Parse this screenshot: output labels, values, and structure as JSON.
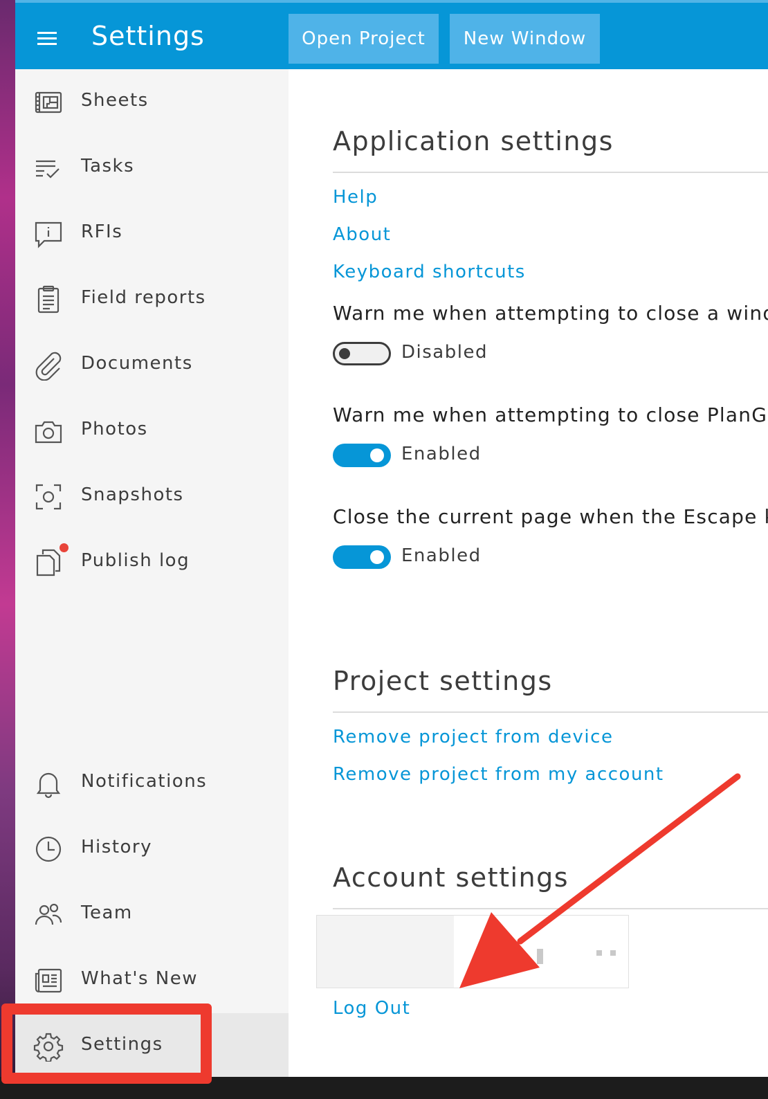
{
  "header": {
    "title": "Settings",
    "open_project_label": "Open Project",
    "new_window_label": "New Window"
  },
  "sidebar": {
    "items": [
      {
        "label": "Sheets",
        "icon": "sheets-icon"
      },
      {
        "label": "Tasks",
        "icon": "tasks-icon"
      },
      {
        "label": "RFIs",
        "icon": "rfi-icon"
      },
      {
        "label": "Field reports",
        "icon": "clipboard-icon"
      },
      {
        "label": "Documents",
        "icon": "paperclip-icon"
      },
      {
        "label": "Photos",
        "icon": "camera-icon"
      },
      {
        "label": "Snapshots",
        "icon": "snapshot-icon"
      },
      {
        "label": "Publish log",
        "icon": "copy-icon"
      },
      {
        "label": "Notifications",
        "icon": "bell-icon"
      },
      {
        "label": "History",
        "icon": "clock-icon"
      },
      {
        "label": "Team",
        "icon": "people-icon"
      },
      {
        "label": "What's New",
        "icon": "newspaper-icon"
      },
      {
        "label": "Settings",
        "icon": "gear-icon"
      }
    ],
    "active": "Settings"
  },
  "main": {
    "application": {
      "title": "Application settings",
      "links": [
        "Help",
        "About",
        "Keyboard shortcuts"
      ],
      "settings": [
        {
          "label": "Warn me when attempting to close a wind",
          "state": "Disabled",
          "on": false
        },
        {
          "label": "Warn me when attempting to close PlanG",
          "state": "Enabled",
          "on": true
        },
        {
          "label": "Close the current page when the Escape k",
          "state": "Enabled",
          "on": true
        }
      ]
    },
    "project": {
      "title": "Project settings",
      "links": [
        "Remove project from device",
        "Remove project from my account"
      ]
    },
    "account": {
      "title": "Account settings",
      "logout_label": "Log Out"
    }
  },
  "colors": {
    "accent": "#0696d7",
    "annotation": "#ee3a2e"
  }
}
